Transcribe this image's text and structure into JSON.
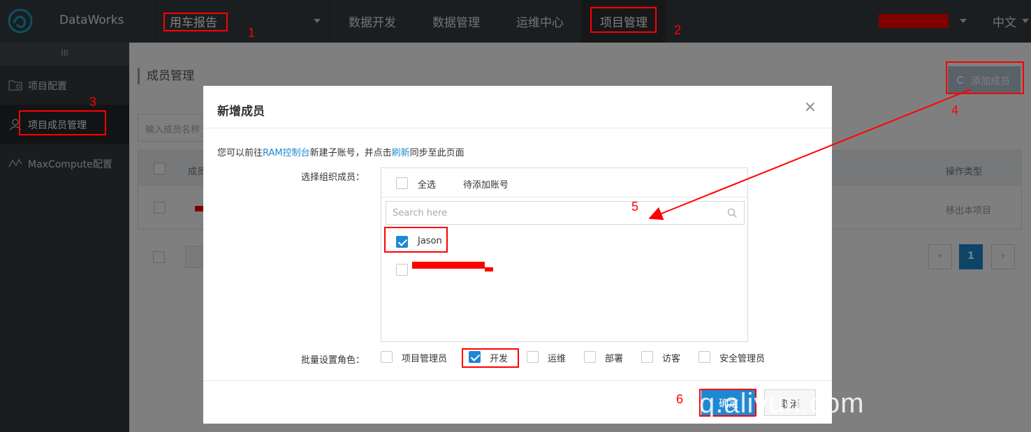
{
  "topbar": {
    "brand": "DataWorks",
    "project": "用车报告",
    "nav": [
      {
        "label": "数据开发"
      },
      {
        "label": "数据管理"
      },
      {
        "label": "运维中心"
      },
      {
        "label": "项目管理"
      }
    ],
    "lang": "中文"
  },
  "sidebar": {
    "toggle": "III",
    "items": [
      {
        "label": "项目配置"
      },
      {
        "label": "项目成员管理"
      },
      {
        "label": "MaxCompute配置"
      }
    ]
  },
  "main": {
    "title": "成员管理",
    "add_button": "添加成员",
    "filter_placeholder": "输入成员名称",
    "table": {
      "col_name": "成员",
      "col_ops": "操作类型",
      "row_action": "移出本项目"
    },
    "pager": {
      "current": "1",
      "prev": "‹",
      "next": "›"
    }
  },
  "modal": {
    "title": "新增成员",
    "close": "×",
    "info_prefix": "您可以前往",
    "info_link1": "RAM控制台",
    "info_mid": "新建子账号，并点击",
    "info_link2": "刷新",
    "info_suffix": "同步至此页面",
    "select_label": "选择组织成员：",
    "select_all": "全选",
    "pending": "待添加账号",
    "search_placeholder": "Search here",
    "members": [
      {
        "name": "Jason",
        "checked": true
      }
    ],
    "role_label": "批量设置角色：",
    "roles": [
      {
        "label": "项目管理员",
        "checked": false
      },
      {
        "label": "开发",
        "checked": true
      },
      {
        "label": "运维",
        "checked": false
      },
      {
        "label": "部署",
        "checked": false
      },
      {
        "label": "访客",
        "checked": false
      },
      {
        "label": "安全管理员",
        "checked": false
      }
    ],
    "ok": "确定",
    "cancel": "取消"
  },
  "annotations": [
    "1",
    "2",
    "3",
    "4",
    "5",
    "6"
  ],
  "watermark": "yq.aliyun.com",
  "colors": {
    "accent": "#1e88d2",
    "topbar": "#373d41",
    "sidebar": "#34393d",
    "annotation": "#ff0000"
  }
}
